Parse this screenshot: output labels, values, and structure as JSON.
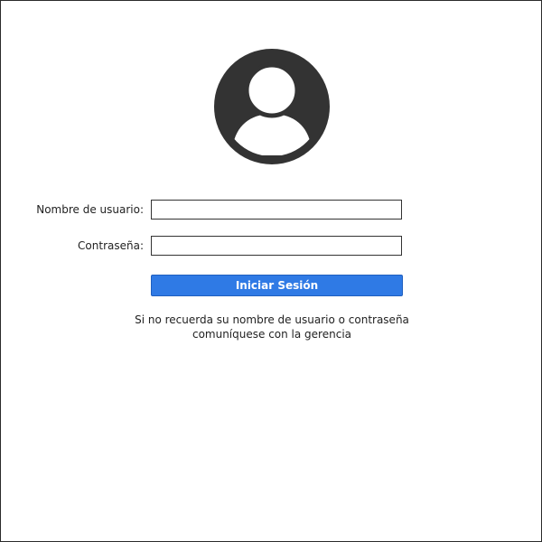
{
  "avatar": {
    "icon": "user-avatar-icon",
    "color": "#333333"
  },
  "form": {
    "username_label": "Nombre de usuario:",
    "username_value": "",
    "password_label": "Contraseña:",
    "password_value": "",
    "submit_label": "Iniciar Sesión",
    "submit_color": "#2f7ae5"
  },
  "help": {
    "line1": "Si no recuerda su nombre de usuario o contraseña",
    "line2": "comuníquese con la gerencia"
  }
}
